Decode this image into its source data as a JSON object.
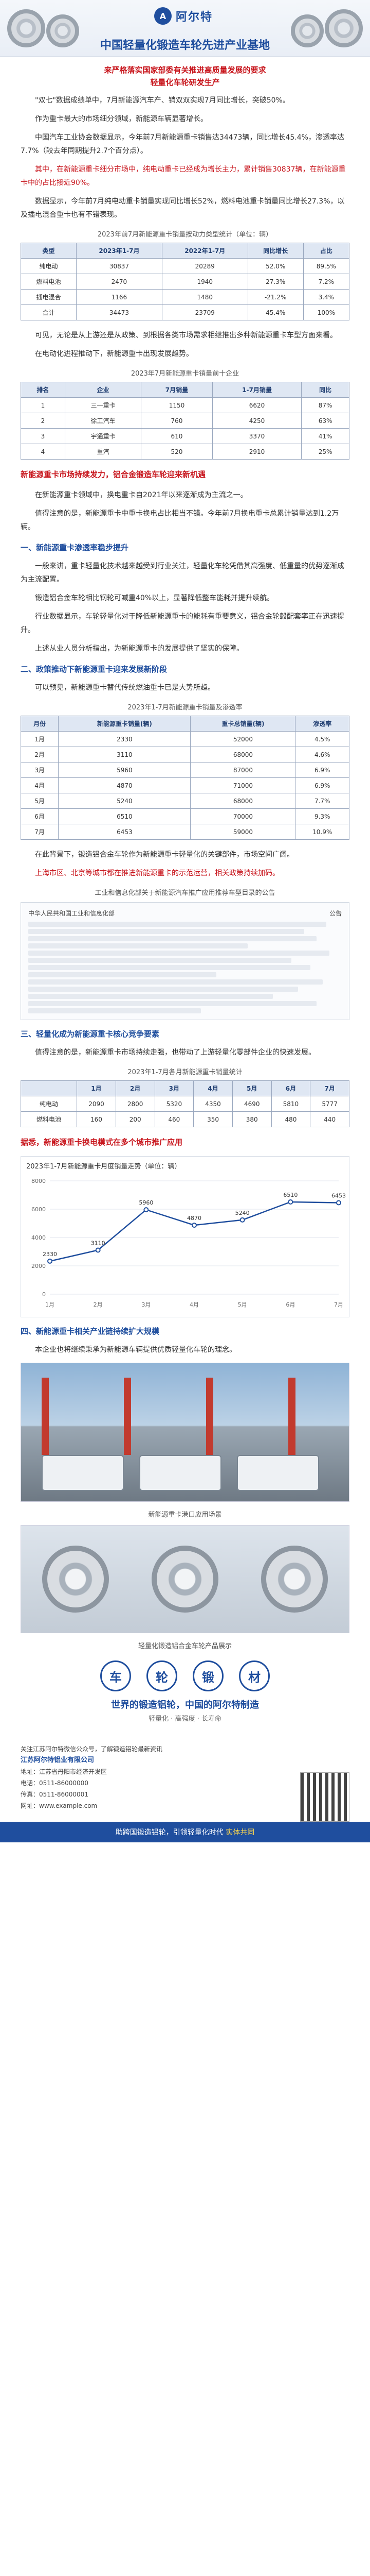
{
  "banner": {
    "brand": "阿尔特",
    "title": "中国轻量化锻造车轮先进产业基地"
  },
  "subtitle": {
    "line1": "来严格落实国家部委有关推进高质量发展的要求",
    "line2": "轻量化车轮研发生产"
  },
  "paragraphs": {
    "p1": "\"双七\"数据成绩单中，7月新能源汽车产、销双双实现7月同比增长，突破50%。",
    "p2": "作为重卡最大的市场细分领域，新能源车辆显著增长。",
    "p3": "中国汽车工业协会数据显示，今年前7月新能源重卡销售达34473辆，同比增长45.4%，渗透率达7.7%（较去年同期提升2.7个百分点）。",
    "p4": "其中，在新能源重卡细分市场中，纯电动重卡已经成为增长主力，累计销售30837辆，在新能源重卡中的占比接近90%。",
    "p5": "数据显示，今年前7月纯电动重卡销量实现同比增长52%，燃料电池重卡销量同比增长27.3%，以及插电混合重卡也有不错表现。",
    "p6": "可见，无论是从上游还是从政策、到根据各类市场需求相继推出多种新能源重卡车型方面来看。",
    "p7": "在电动化进程推动下，新能源重卡出现发展趋势。",
    "p8": "在新能源重卡领域中，换电重卡自2021年以来逐渐成为主流之一。",
    "p9": "值得注意的是，新能源重卡中重卡换电占比相当不错。今年前7月换电重卡总累计销量达到1.2万辆。",
    "p10": "一般来讲，重卡轻量化技术越来越受到行业关注，轻量化车轮凭借其高强度、低重量的优势逐渐成为主流配置。",
    "p11": "锻造铝合金车轮相比钢轮可减重40%以上，显著降低整车能耗并提升续航。",
    "p12": "行业数据显示，车轮轻量化对于降低新能源重卡的能耗有重要意义，铝合金轮毂配套率正在迅速提升。",
    "p13": "上述从业人员分析指出，为新能源重卡的发展提供了坚实的保障。",
    "p14": "可以预见，新能源重卡替代传统燃油重卡已是大势所趋。",
    "p15": "在此背景下，锻造铝合金车轮作为新能源重卡轻量化的关键部件，市场空间广阔。",
    "p16": "上海市区、北京等城市都在推进新能源重卡的示范运营，相关政策持续加码。",
    "p17": "值得注意的是，新能源重卡市场持续走强，也带动了上游轻量化零部件企业的快速发展。",
    "p18": "本企业也将继续秉承为新能源车辆提供优质轻量化车轮的理念。"
  },
  "highlights": {
    "h1": "新能源重卡市场持续发力，铝合金锻造车轮迎来新机遇",
    "h2": "一、新能源重卡渗透率稳步提升",
    "h3": "二、政策推动下新能源重卡迎来发展新阶段",
    "h4": "三、轻量化成为新能源重卡核心竞争要素",
    "h5": "据悉，新能源重卡换电模式在多个城市推广应用",
    "h6": "四、新能源重卡相关产业链持续扩大规模"
  },
  "captions": {
    "table1": "2023年前7月新能源重卡销量按动力类型统计（单位：辆）",
    "table2": "2023年7月新能源重卡销量前十企业",
    "table3": "2023年1-7月新能源重卡销量及渗透率",
    "table4": "2023年1-7月各月新能源重卡销量统计",
    "notice": "工业和信息化部关于新能源汽车推广应用推荐车型目录的公告",
    "chart": "2023年1-7月新能源重卡月度销量走势（单位：辆）",
    "photo1": "新能源重卡港口应用场景",
    "photo2": "轻量化锻造铝合金车轮产品展示"
  },
  "table1": {
    "headers": [
      "类型",
      "2023年1-7月",
      "2022年1-7月",
      "同比增长",
      "占比"
    ],
    "rows": [
      [
        "纯电动",
        "30837",
        "20289",
        "52.0%",
        "89.5%"
      ],
      [
        "燃料电池",
        "2470",
        "1940",
        "27.3%",
        "7.2%"
      ],
      [
        "插电混合",
        "1166",
        "1480",
        "-21.2%",
        "3.4%"
      ],
      [
        "合计",
        "34473",
        "23709",
        "45.4%",
        "100%"
      ]
    ]
  },
  "table2": {
    "headers": [
      "排名",
      "企业",
      "7月销量",
      "1-7月销量",
      "同比"
    ],
    "rows": [
      [
        "1",
        "三一重卡",
        "1150",
        "6620",
        "87%"
      ],
      [
        "2",
        "徐工汽车",
        "760",
        "4250",
        "63%"
      ],
      [
        "3",
        "宇通重卡",
        "610",
        "3370",
        "41%"
      ],
      [
        "4",
        "重汽",
        "520",
        "2910",
        "25%"
      ]
    ]
  },
  "table3": {
    "headers": [
      "月份",
      "新能源重卡销量(辆)",
      "重卡总销量(辆)",
      "渗透率"
    ],
    "rows": [
      [
        "1月",
        "2330",
        "52000",
        "4.5%"
      ],
      [
        "2月",
        "3110",
        "68000",
        "4.6%"
      ],
      [
        "3月",
        "5960",
        "87000",
        "6.9%"
      ],
      [
        "4月",
        "4870",
        "71000",
        "6.9%"
      ],
      [
        "5月",
        "5240",
        "68000",
        "7.7%"
      ],
      [
        "6月",
        "6510",
        "70000",
        "9.3%"
      ],
      [
        "7月",
        "6453",
        "59000",
        "10.9%"
      ]
    ]
  },
  "table4": {
    "headers": [
      "",
      "1月",
      "2月",
      "3月",
      "4月",
      "5月",
      "6月",
      "7月"
    ],
    "rows": [
      [
        "纯电动",
        "2090",
        "2800",
        "5320",
        "4350",
        "4690",
        "5810",
        "5777"
      ],
      [
        "燃料电池",
        "160",
        "200",
        "460",
        "350",
        "380",
        "480",
        "440"
      ]
    ]
  },
  "notice": {
    "left": "中华人民共和国工业和信息化部",
    "right": "公告"
  },
  "chart_data": {
    "type": "line",
    "categories": [
      "1月",
      "2月",
      "3月",
      "4月",
      "5月",
      "6月",
      "7月"
    ],
    "series": [
      {
        "name": "新能源重卡销量",
        "values": [
          2330,
          3110,
          5960,
          4870,
          5240,
          6510,
          6453
        ]
      }
    ],
    "ylim": [
      0,
      8000
    ],
    "grid": true,
    "color": "#1f4e9e"
  },
  "icons": [
    "车",
    "轮",
    "锻",
    "材"
  ],
  "slogan": {
    "main": "世界的锻造铝轮，中国的阿尔特制造",
    "sub": "轻量化 · 高强度 · 长寿命"
  },
  "contact": {
    "intro": "关注江苏阿尔特微信公众号，了解锻造铝轮最新资讯",
    "company": "江苏阿尔特铝业有限公司",
    "address": "地址：江苏省丹阳市经济开发区",
    "phone": "电话：0511-86000000",
    "fax": "传真：0511-86000001",
    "web": "网址：www.example.com"
  },
  "footer": {
    "text": "助跨国锻造铝轮，引领轻量化时代",
    "tag": "实体共同"
  }
}
